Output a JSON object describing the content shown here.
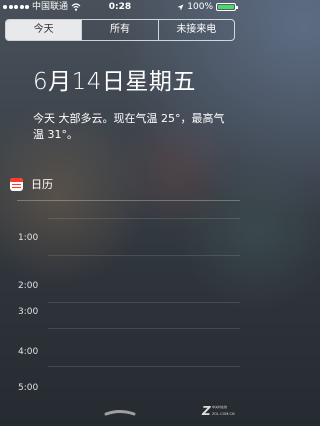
{
  "status_bar": {
    "carrier": "中国联通",
    "time": "0:28",
    "battery_percent": "100%",
    "battery_level": 1.0,
    "signal_bars": 5,
    "icons": [
      "signal-icon",
      "wifi-icon",
      "location-arrow-icon",
      "battery-icon"
    ]
  },
  "tabs": [
    {
      "label": "今天",
      "selected": true
    },
    {
      "label": "所有",
      "selected": false
    },
    {
      "label": "未接来电",
      "selected": false
    }
  ],
  "today": {
    "date": "6月14日星期五",
    "summary": "今天 大部多云。现在气温 25°，最高气温 31°。"
  },
  "calendar": {
    "title": "日历",
    "icon": "calendar-icon",
    "hours": [
      "1:00",
      "2:00",
      "3:00",
      "4:00",
      "5:00"
    ]
  },
  "watermark": {
    "mark": "Z",
    "subtitle": "中关村在线",
    "url": "ZOL.COM.CN"
  },
  "colors": {
    "battery_fill": "#4cd964",
    "calendar_red": "#ff3b30",
    "segment_selected_bg": "#ffffff"
  }
}
